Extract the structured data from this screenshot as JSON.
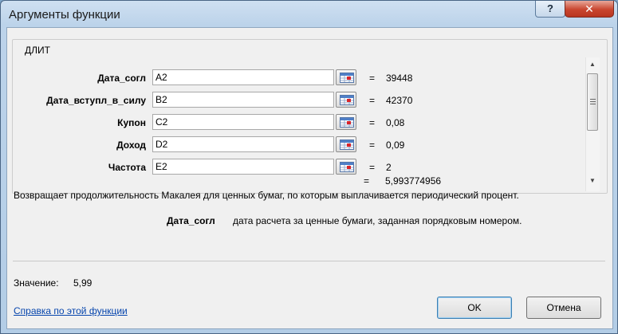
{
  "window": {
    "title": "Аргументы функции",
    "help_glyph": "?",
    "close_glyph": "✕"
  },
  "function": {
    "name": "ДЛИТ",
    "arguments": [
      {
        "label": "Дата_согл",
        "ref": "A2",
        "value": "39448"
      },
      {
        "label": "Дата_вступл_в_силу",
        "ref": "B2",
        "value": "42370"
      },
      {
        "label": "Купон",
        "ref": "C2",
        "value": "0,08"
      },
      {
        "label": "Доход",
        "ref": "D2",
        "value": "0,09"
      },
      {
        "label": "Частота",
        "ref": "E2",
        "value": "2"
      }
    ],
    "equals": "=",
    "result": "5,993774956",
    "description": "Возвращает продолжительность Макалея для ценных бумаг, по которым выплачивается периодический процент.",
    "arg_desc_name": "Дата_согл",
    "arg_desc_text": "дата расчета за ценные бумаги, заданная порядковым номером."
  },
  "footer": {
    "value_label": "Значение:",
    "value": "5,99",
    "help_link": "Справка по этой функции",
    "ok_label": "OK",
    "cancel_label": "Отмена"
  },
  "icons": {
    "help": "help-icon",
    "close": "close-icon",
    "ref": "collapse-dialog-icon",
    "scroll_up": "scroll-up-icon",
    "scroll_down": "scroll-down-icon"
  },
  "colors": {
    "titlebar": "#bcd3ea",
    "close": "#c9462f",
    "link": "#0645ad",
    "ok_focus": "#3c7fb1"
  }
}
